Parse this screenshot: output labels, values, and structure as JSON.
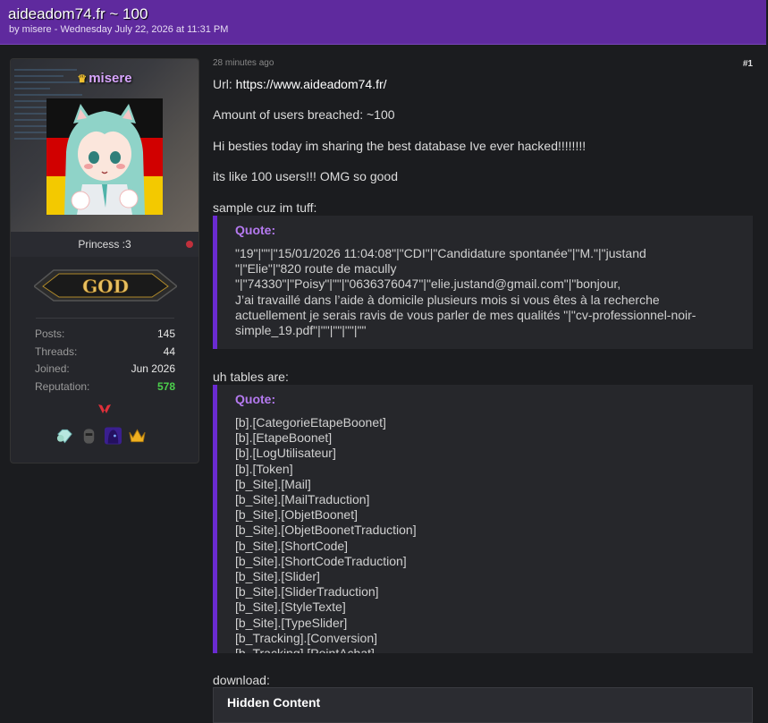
{
  "header": {
    "title": "aideadom74.fr ~ 100",
    "byline": "by misere - Wednesday July 22, 2026 at 11:31 PM"
  },
  "user": {
    "name": "misere",
    "title": "Princess :3",
    "rank_label": "GOD",
    "stats": [
      {
        "label": "Posts:",
        "value": "145"
      },
      {
        "label": "Threads:",
        "value": "44"
      },
      {
        "label": "Joined:",
        "value": "Jun 2026"
      },
      {
        "label": "Reputation:",
        "value": "578"
      }
    ],
    "accent_color": "#d9a6ff"
  },
  "post": {
    "time": "28 minutes ago",
    "number": "#1",
    "url_label": "Url:",
    "url": "https://www.aideadom74.fr/",
    "line_users": "Amount of users breached: ~100",
    "line_intro": "Hi besties today im sharing the best database Ive ever hacked!!!!!!!!",
    "line_hype": "its like 100 users!!! OMG so good",
    "sample_label": "sample cuz im tuff:",
    "quote1_label": "Quote:",
    "quote1_text": "\"19\"|\"\"|\"15/01/2026 11:04:08\"|\"CDI\"|\"Candidature spontanée\"|\"M.\"|\"justand\n\"|\"Elie\"|\"820 route de macully\n\"|\"74330\"|\"Poisy\"|\"\"|\"0636376047\"|\"elie.justand@gmail.com\"|\"bonjour,\nJ’ai travaillé dans l’aide à domicile plusieurs mois si vous êtes à la recherche\nactuellement je serais ravis de vous parler de mes qualités \"|\"cv-professionnel-noir-\nsimple_19.pdf\"|\"\"|\"\"|\"\"|\"\"",
    "tables_label": "uh tables are:",
    "quote2_label": "Quote:",
    "quote2_text": "[b].[CategorieEtapeBoonet]\n[b].[EtapeBoonet]\n[b].[LogUtilisateur]\n[b].[Token]\n[b_Site].[Mail]\n[b_Site].[MailTraduction]\n[b_Site].[ObjetBoonet]\n[b_Site].[ObjetBoonetTraduction]\n[b_Site].[ShortCode]\n[b_Site].[ShortCodeTraduction]\n[b_Site].[Slider]\n[b_Site].[SliderTraduction]\n[b_Site].[StyleTexte]\n[b_Site].[TypeSlider]\n[b_Tracking].[Conversion]\n[b_Tracking].[PointAchat]",
    "download_label": "download:",
    "hidden_label": "Hidden Content"
  },
  "colors": {
    "header_bg": "#5f2a9e",
    "quote_border": "#6a2bd1",
    "reputation": "#4cd04c"
  }
}
